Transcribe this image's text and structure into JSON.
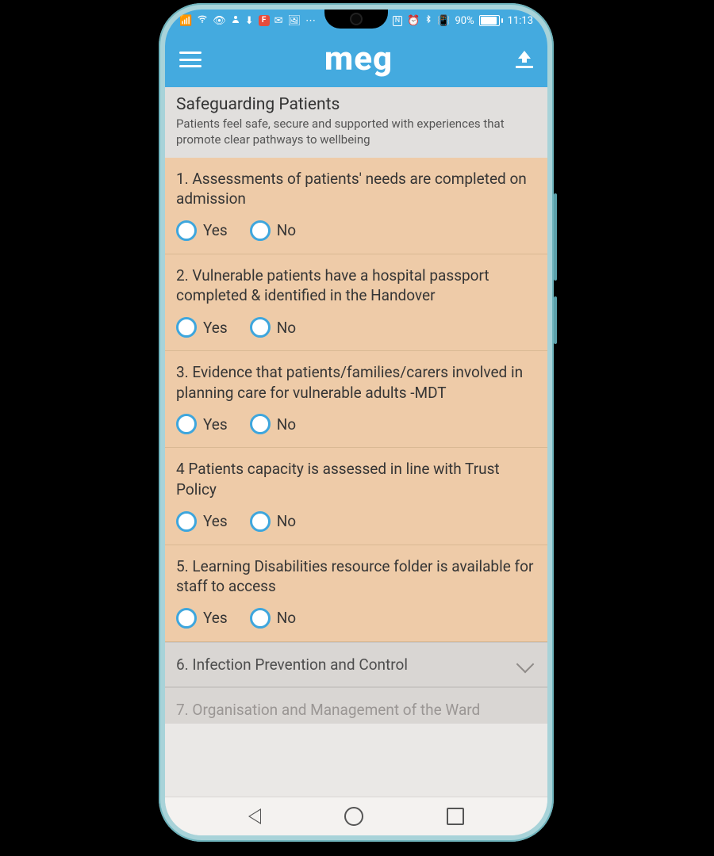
{
  "status": {
    "left_icons": [
      "signal-icon",
      "wifi-icon",
      "eye-icon",
      "person-icon",
      "download-icon"
    ],
    "badge_text": "F",
    "badge_bg": "#e74c3c",
    "right_text_nfc": "N",
    "right_icons": [
      "alarm-icon",
      "bluetooth-icon",
      "vibrate-icon"
    ],
    "battery_pct": "90%",
    "time": "11:13"
  },
  "appbar": {
    "logo_text": "meg"
  },
  "section": {
    "title": "Safeguarding Patients",
    "subtitle": "Patients feel safe, secure and supported with experiences that promote clear pathways to wellbeing"
  },
  "questions": [
    {
      "text": "1. Assessments of patients' needs are completed on admission",
      "yes": "Yes",
      "no": "No"
    },
    {
      "text": "2. Vulnerable patients have a hospital passport completed & identified in the Handover",
      "yes": "Yes",
      "no": "No"
    },
    {
      "text": "3. Evidence that patients/families/carers involved in planning care for vulnerable adults -MDT",
      "yes": "Yes",
      "no": "No"
    },
    {
      "text": "4 Patients capacity is assessed in line with Trust Policy",
      "yes": "Yes",
      "no": "No"
    },
    {
      "text": "5. Learning Disabilities resource folder is available for staff to access",
      "yes": "Yes",
      "no": "No"
    }
  ],
  "collapsed": [
    "6. Infection Prevention and Control",
    "7. Organisation and Management of the Ward"
  ]
}
